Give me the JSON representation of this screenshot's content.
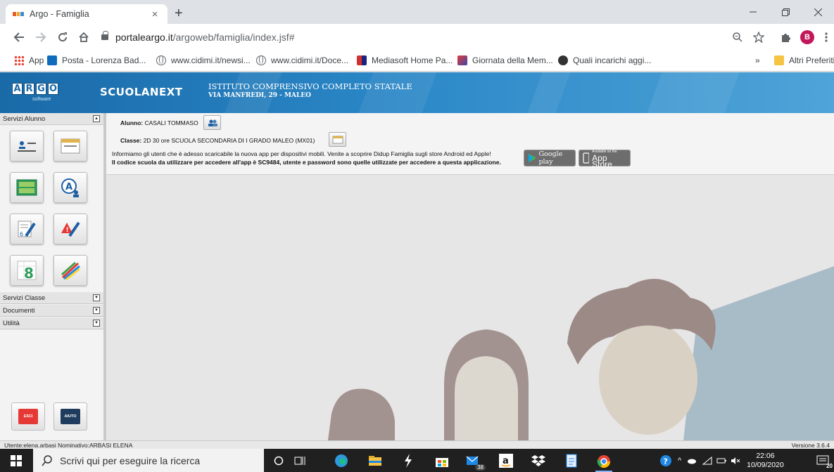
{
  "browser": {
    "tab_title": "Argo - Famiglia",
    "tab_close": "×",
    "new_tab": "+",
    "url_domain": "portaleargo.it",
    "url_path": "/argoweb/famiglia/index.jsf#",
    "profile_initial": "B"
  },
  "bookmarks": {
    "apps": "App",
    "items": [
      "Posta - Lorenza Bad...",
      "www.cidimi.it/newsi...",
      "www.cidimi.it/Doce...",
      "Mediasoft Home Pa...",
      "Giornata della Mem...",
      "Quali incarichi aggi..."
    ],
    "more": "»",
    "other_folder": "Altri Preferiti"
  },
  "header": {
    "logo_letters": [
      "A",
      "R",
      "G",
      "O"
    ],
    "logo_sub": "software",
    "product": "SCUOLANEXT",
    "school_name": "ISTITUTO COMPRENSIVO COMPLETO STATALE",
    "school_address": "VIA MANFREDI, 29 - MALEO"
  },
  "sidebar": {
    "servizi_alunno": "Servizi Alunno",
    "servizi_classe": "Servizi Classe",
    "documenti": "Documenti",
    "utilita": "Utilità",
    "esci": "ESCI",
    "aiuto": "AIUTO"
  },
  "info": {
    "alunno_label": "Alunno:",
    "alunno_value": "CASALI TOMMASO",
    "classe_label": "Classe:",
    "classe_value": "2D 30 ore SCUOLA SECONDARIA DI I GRADO MALEO (MX01)",
    "notice_line1": "Informiamo gli utenti che è adesso scaricabile la nuova app per dispositivi mobili. Venite a scoprire Didup Famiglia sugli store Android ed Apple!",
    "notice_line2": "Il codice scuola da utilizzare per accedere all'app è SC9484, utente e password sono quelle utilizzate per accedere a questa applicazione.",
    "google_play": "Google play",
    "app_store_small": "Available on the",
    "app_store": "App Store"
  },
  "status": {
    "user": "Utente:elena.arbasi Nominativo:ARBASI ELENA",
    "version": "Versione 3.6.4"
  },
  "taskbar": {
    "search_placeholder": "Scrivi qui per eseguire la ricerca",
    "mail_badge": "38",
    "time": "22:06",
    "date": "10/09/2020",
    "notif_count": "20"
  },
  "colors": {
    "argo_blue": "#1a6aa8",
    "canvas_bg": "#e7e6e6",
    "taskbar_bg": "#202020"
  }
}
